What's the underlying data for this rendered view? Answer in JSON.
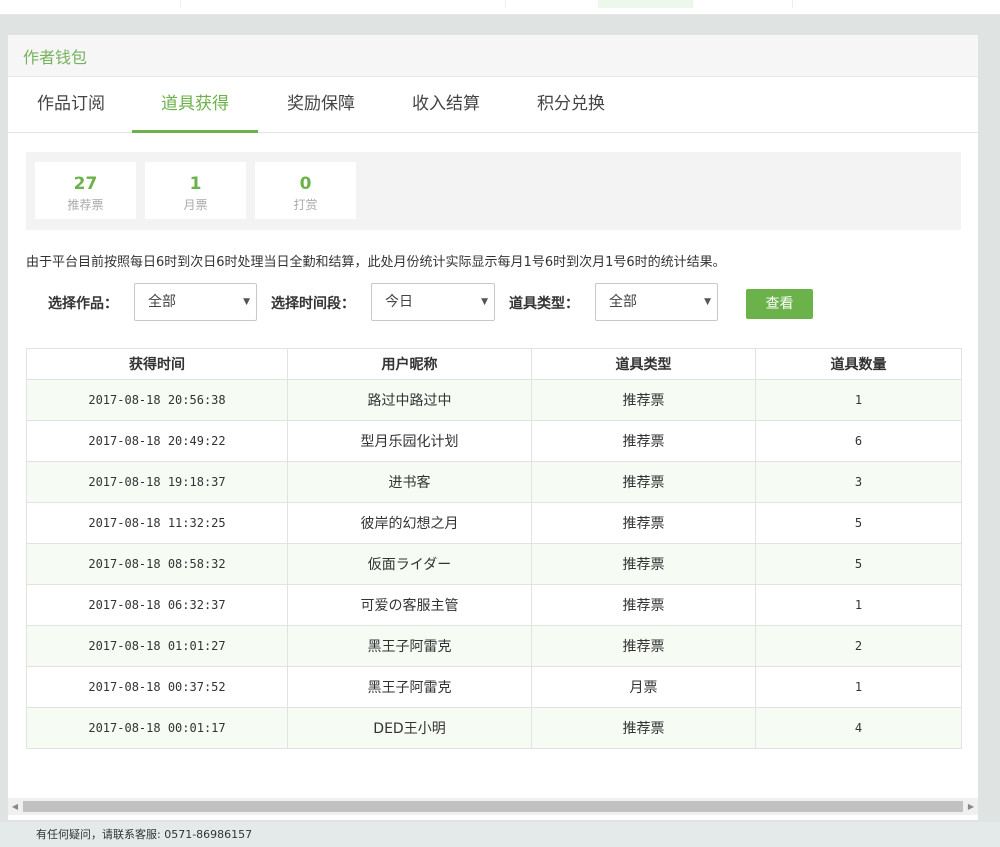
{
  "panel": {
    "title": "作者钱包"
  },
  "tabs": [
    {
      "label": "作品订阅"
    },
    {
      "label": "道具获得"
    },
    {
      "label": "奖励保障"
    },
    {
      "label": "收入结算"
    },
    {
      "label": "积分兑换"
    }
  ],
  "active_tab": "道具获得",
  "stats": [
    {
      "value": "27",
      "label": "推荐票"
    },
    {
      "value": "1",
      "label": "月票"
    },
    {
      "value": "0",
      "label": "打赏"
    }
  ],
  "note": "由于平台目前按照每日6时到次日6时处理当日全勤和结算，此处月份统计实际显示每月1号6时到次月1号6时的统计结果。",
  "filters": {
    "work_label": "选择作品：",
    "work_value": "全部",
    "period_label": "选择时间段：",
    "period_value": "今日",
    "type_label": "道具类型：",
    "type_value": "全部",
    "view_button": "查看"
  },
  "table": {
    "columns": [
      "获得时间",
      "用户昵称",
      "道具类型",
      "道具数量"
    ],
    "rows": [
      [
        "2017-08-18 20:56:38",
        "路过中路过中",
        "推荐票",
        "1"
      ],
      [
        "2017-08-18 20:49:22",
        "型月乐园化计划",
        "推荐票",
        "6"
      ],
      [
        "2017-08-18 19:18:37",
        "进书客",
        "推荐票",
        "3"
      ],
      [
        "2017-08-18 11:32:25",
        "彼岸的幻想之月",
        "推荐票",
        "5"
      ],
      [
        "2017-08-18 08:58:32",
        "仮面ライダー",
        "推荐票",
        "5"
      ],
      [
        "2017-08-18 06:32:37",
        "可爱の客服主管",
        "推荐票",
        "1"
      ],
      [
        "2017-08-18 01:01:27",
        "黑王子阿雷克",
        "推荐票",
        "2"
      ],
      [
        "2017-08-18 00:37:52",
        "黑王子阿雷克",
        "月票",
        "1"
      ],
      [
        "2017-08-18 00:01:17",
        "DED王小明",
        "推荐票",
        "4"
      ]
    ]
  },
  "footer": {
    "text": "有任何疑问，请联系客服: 0571-86986157"
  },
  "icons": {
    "select_caret": "caret-down-icon",
    "scroll_left": "scroll-left-arrow-icon",
    "scroll_right": "scroll-right-arrow-icon"
  },
  "colors": {
    "accent": "#6cb24b",
    "title": "#77b35d",
    "row_alt": "#f6fbf4"
  }
}
